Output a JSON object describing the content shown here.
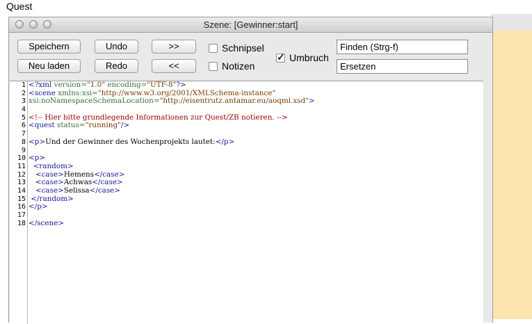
{
  "app": {
    "title": "Quest"
  },
  "window": {
    "title": "Szene: [Gewinner:start]"
  },
  "toolbar": {
    "save": "Speichern",
    "reload": "Neu laden",
    "undo": "Undo",
    "redo": "Redo",
    "forward": ">>",
    "back": "<<",
    "snippets": "Schnipsel",
    "notes": "Notizen",
    "wrap": "Umbruch",
    "find": "Finden (Strg-f)",
    "replace": "Ersetzen"
  },
  "editor": {
    "line_numbers": [
      "1",
      "2",
      "3",
      "4",
      "5",
      "6",
      "7",
      "8",
      "9",
      "10",
      "11",
      "12",
      "13",
      "14",
      "15",
      "16",
      "17",
      "18"
    ],
    "lines": [
      [
        {
          "t": "<?xml ",
          "c": "tag"
        },
        {
          "t": "version=",
          "c": "attr"
        },
        {
          "t": "\"1.0\"",
          "c": "val"
        },
        {
          "t": " encoding=",
          "c": "attr"
        },
        {
          "t": "\"UTF-8\"",
          "c": "val"
        },
        {
          "t": "?>",
          "c": "tag"
        }
      ],
      [
        {
          "t": "<scene ",
          "c": "tag"
        },
        {
          "t": "xmlns:xsi=",
          "c": "attr"
        },
        {
          "t": "\"http://www.w3.org/2001/XMLSchema-instance\"",
          "c": "val"
        }
      ],
      [
        {
          "t": "xsi:noNamespaceSchemaLocation=",
          "c": "attr"
        },
        {
          "t": "\"http://eisentrutz.antamar.eu/aoqml.xsd\"",
          "c": "val"
        },
        {
          "t": ">",
          "c": "tag"
        }
      ],
      [],
      [
        {
          "t": "<!-- Hier bitte grundlegende Informationen zur Quest/ZB notieren. -->",
          "c": "comment"
        }
      ],
      [
        {
          "t": "<quest ",
          "c": "tag"
        },
        {
          "t": "status=",
          "c": "attr"
        },
        {
          "t": "\"running\"",
          "c": "val"
        },
        {
          "t": "/>",
          "c": "tag"
        }
      ],
      [],
      [
        {
          "t": "<p>",
          "c": "tag"
        },
        {
          "t": "Und der Gewinner des Wochenprojekts lautet:",
          "c": "text"
        },
        {
          "t": "</p>",
          "c": "tag"
        }
      ],
      [],
      [
        {
          "t": "<p>",
          "c": "tag"
        }
      ],
      [
        {
          "t": "  <random>",
          "c": "tag"
        }
      ],
      [
        {
          "t": "   <case>",
          "c": "tag"
        },
        {
          "t": "Hemens",
          "c": "text"
        },
        {
          "t": "</case>",
          "c": "tag"
        }
      ],
      [
        {
          "t": "   <case>",
          "c": "tag"
        },
        {
          "t": "Achwas",
          "c": "text"
        },
        {
          "t": "</case>",
          "c": "tag"
        }
      ],
      [
        {
          "t": "   <case>",
          "c": "tag"
        },
        {
          "t": "Selissa",
          "c": "text"
        },
        {
          "t": "</case>",
          "c": "tag"
        }
      ],
      [
        {
          "t": " </random>",
          "c": "tag"
        }
      ],
      [
        {
          "t": "</p>",
          "c": "tag"
        }
      ],
      [],
      [
        {
          "t": "</scene>",
          "c": "tag"
        }
      ],
      []
    ]
  }
}
